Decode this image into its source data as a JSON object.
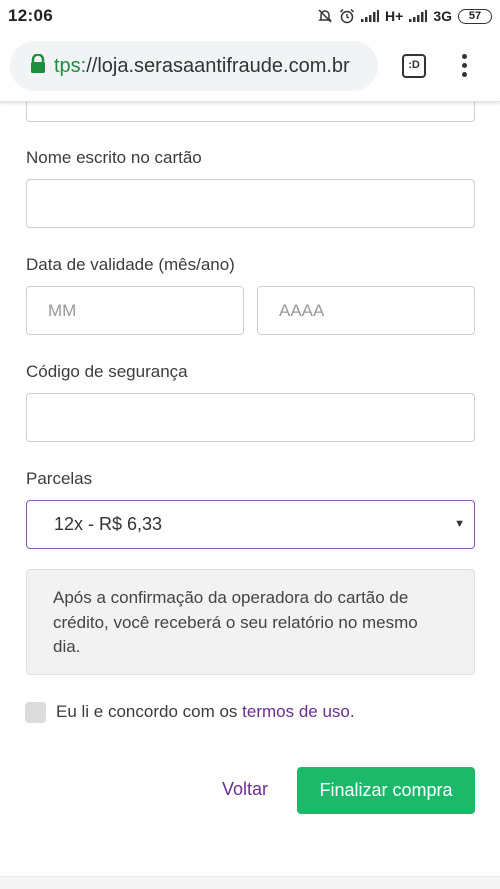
{
  "status_bar": {
    "time": "12:06",
    "network_1": "H+",
    "network_2": "3G",
    "battery": "57"
  },
  "browser": {
    "url_scheme": "tps:",
    "url_rest": "//loja.serasaantifraude.com.br",
    "tab_count": ":D"
  },
  "form": {
    "name_label": "Nome escrito no cartão",
    "expiry_label": "Data de validade (mês/ano)",
    "month_placeholder": "MM",
    "year_placeholder": "AAAA",
    "cvv_label": "Código de segurança",
    "installments_label": "Parcelas",
    "installments_selected": "12x - R$ 6,33",
    "info_text": "Após a confirmação da operadora do cartão de crédito, você receberá o seu relatório no mesmo dia.",
    "terms_prefix": "Eu li e concordo com os ",
    "terms_link": "termos de uso",
    "terms_suffix": ".",
    "back_label": "Voltar",
    "submit_label": "Finalizar compra"
  },
  "colors": {
    "accent_purple": "#6b2f8f",
    "submit_green": "#1db96b",
    "lock_green": "#1e8e3e"
  }
}
